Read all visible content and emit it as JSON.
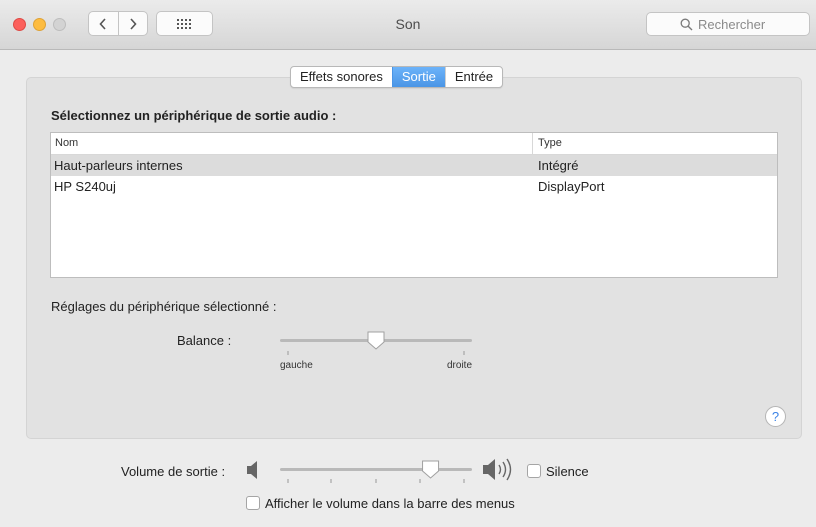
{
  "window": {
    "title": "Son",
    "search_placeholder": "Rechercher",
    "icons": {
      "back": "chevron-left-icon",
      "forward": "chevron-right-icon",
      "show_all": "grid-icon",
      "search": "search-icon"
    }
  },
  "tabs": [
    {
      "label": "Effets sonores",
      "active": false
    },
    {
      "label": "Sortie",
      "active": true
    },
    {
      "label": "Entrée",
      "active": false
    }
  ],
  "output": {
    "section_title": "Sélectionnez un périphérique de sortie audio :",
    "columns": {
      "name": "Nom",
      "type": "Type"
    },
    "devices": [
      {
        "name": "Haut-parleurs internes",
        "type": "Intégré",
        "selected": true
      },
      {
        "name": "HP S240uj",
        "type": "DisplayPort",
        "selected": false
      }
    ],
    "settings_title": "Réglages du périphérique sélectionné :",
    "balance": {
      "label": "Balance :",
      "left_label": "gauche",
      "right_label": "droite",
      "value": 0.5
    }
  },
  "help": {
    "label": "?"
  },
  "volume": {
    "label": "Volume de sortie :",
    "value": 0.81,
    "mute_icon": "speaker-low-icon",
    "loud_icon": "speaker-high-icon"
  },
  "silence": {
    "label": "Silence",
    "checked": false
  },
  "show_in_menubar": {
    "label": "Afficher le volume dans la barre des menus",
    "checked": false
  },
  "colors": {
    "accent": "#4a95e6",
    "close": "#fc605c",
    "minimize": "#fdbc40",
    "zoom_inactive": "#d3d3d3",
    "selected_row": "#dcdcdc"
  }
}
